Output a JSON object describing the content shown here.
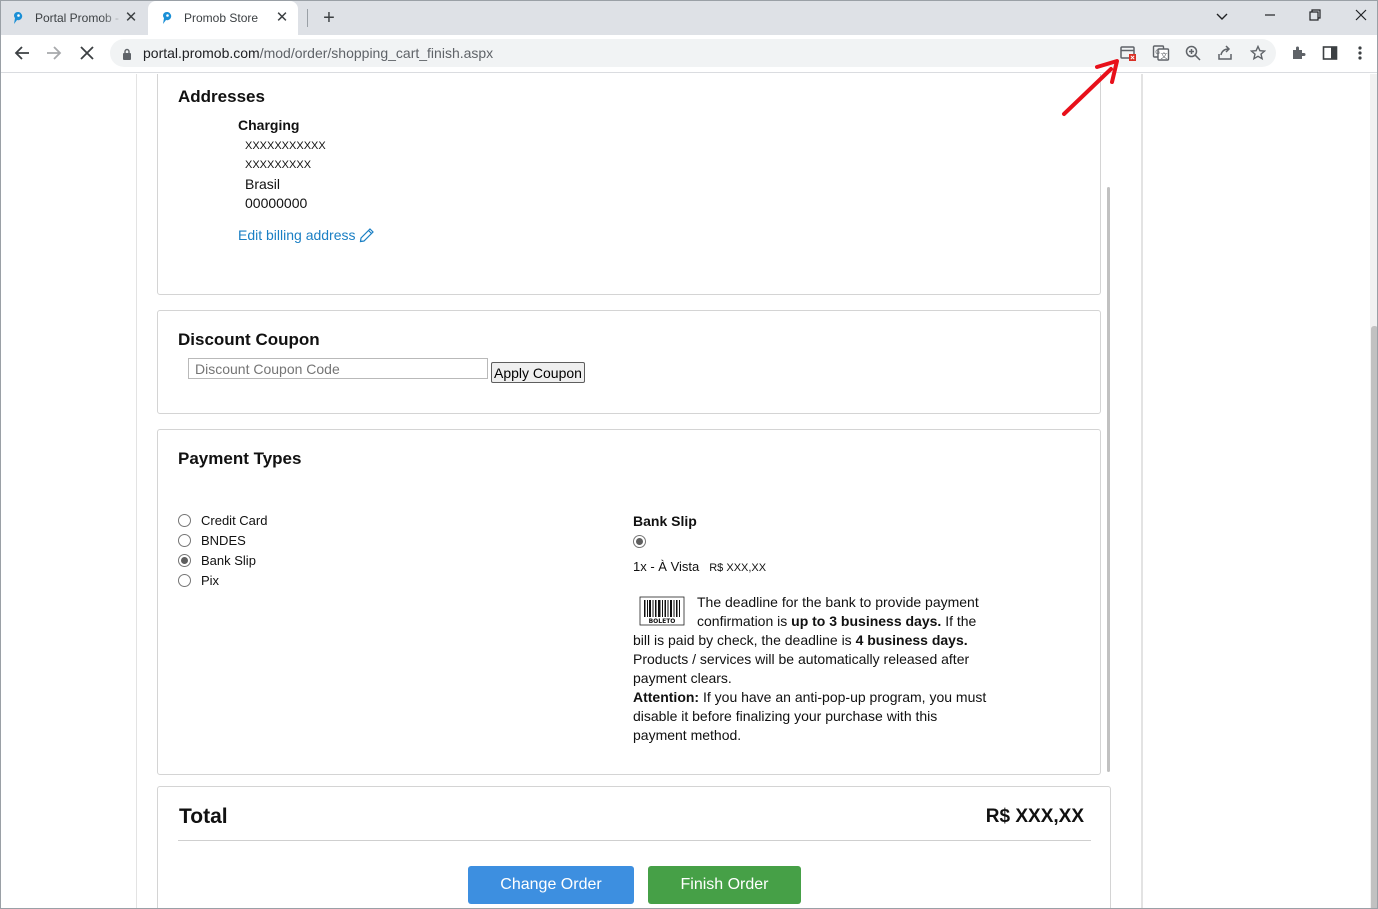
{
  "browser": {
    "tabs": [
      {
        "title": "Portal Promob - ",
        "active": false
      },
      {
        "title": "Promob Store",
        "active": true
      }
    ],
    "url_domain": "portal.promob.com",
    "url_path": "/mod/order/shopping_cart_finish.aspx",
    "toolbar_icons": [
      "popup-blocked-icon",
      "translate-icon",
      "zoom-icon",
      "share-icon",
      "bookmark-star-icon",
      "extensions-icon",
      "side-panel-icon",
      "menu-kebab-icon"
    ],
    "accent_color": "#1a73e8",
    "annotation_color": "#e8101a"
  },
  "addresses": {
    "title": "Addresses",
    "charging_label": "Charging",
    "lines": [
      "XXXXXXXXXXX",
      "XXXXXXXXX",
      "Brasil",
      "00000000"
    ],
    "edit_link": "Edit billing address"
  },
  "coupon": {
    "title": "Discount Coupon",
    "placeholder": "Discount Coupon Code",
    "apply_label": "Apply Coupon"
  },
  "payment": {
    "title": "Payment Types",
    "options": [
      {
        "label": "Credit Card",
        "checked": false
      },
      {
        "label": "BNDES",
        "checked": false
      },
      {
        "label": "Bank Slip",
        "checked": true
      },
      {
        "label": "Pix",
        "checked": false
      }
    ],
    "slip": {
      "title": "Bank Slip",
      "installment": "1x - À Vista",
      "price": "R$ XXX,XX",
      "boleto_label": "BOLETO",
      "text1": "The deadline for the bank to provide payment confirmation is ",
      "bold1": "up to 3 business days.",
      "text2": " If the bill is paid by check, the deadline is ",
      "bold2": "4 business days.",
      "text3": "Products / services will be automatically released after payment clears.",
      "bold3": "Attention:",
      "text4": " If you have an anti-pop-up program, you must disable it before finalizing your purchase with this payment method."
    }
  },
  "total": {
    "label": "Total",
    "value": "R$ XXX,XX",
    "change_order": "Change Order",
    "finish_order": "Finish Order",
    "change_color": "#3d8fe0",
    "finish_color": "#46a047"
  }
}
